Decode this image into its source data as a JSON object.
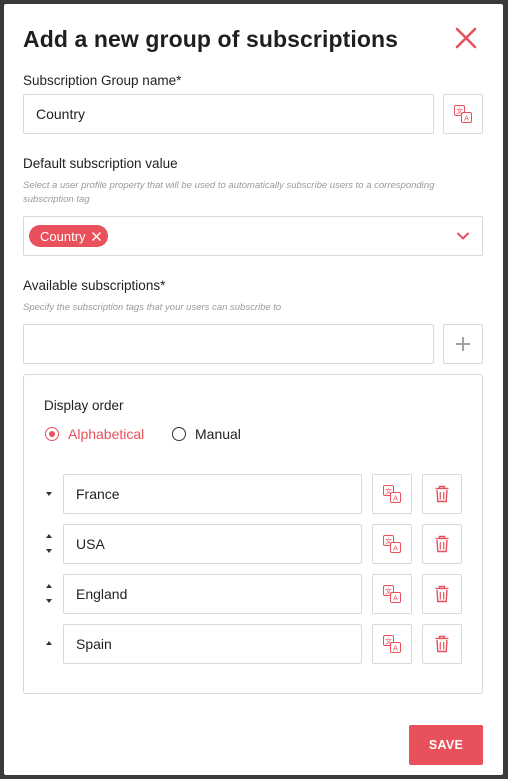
{
  "modal": {
    "title": "Add a new group of subscriptions"
  },
  "group_name": {
    "label": "Subscription Group name*",
    "value": "Country",
    "translate_icon": "translate-icon"
  },
  "default_value": {
    "label": "Default subscription value",
    "hint": "Select a user profile property that will be used to automatically subscribe users to a corresponding subscription tag",
    "selected_chip": "Country",
    "dropdown_icon": "chevron-down-icon"
  },
  "available": {
    "label": "Available subscriptions*",
    "hint": "Specify the subscription tags that your users can subscribe to",
    "input_value": "",
    "add_icon": "plus-icon"
  },
  "display_order": {
    "label": "Display order",
    "options": [
      "Alphabetical",
      "Manual"
    ],
    "selected": "Alphabetical"
  },
  "subscriptions": [
    {
      "name": "France",
      "can_move_up": false,
      "can_move_down": true
    },
    {
      "name": "USA",
      "can_move_up": true,
      "can_move_down": true
    },
    {
      "name": "England",
      "can_move_up": true,
      "can_move_down": true
    },
    {
      "name": "Spain",
      "can_move_up": true,
      "can_move_down": false
    }
  ],
  "footer": {
    "save_label": "SAVE"
  },
  "colors": {
    "accent": "#e8505b",
    "border": "#d9d9d9",
    "overlay": "#3a3a3a"
  }
}
